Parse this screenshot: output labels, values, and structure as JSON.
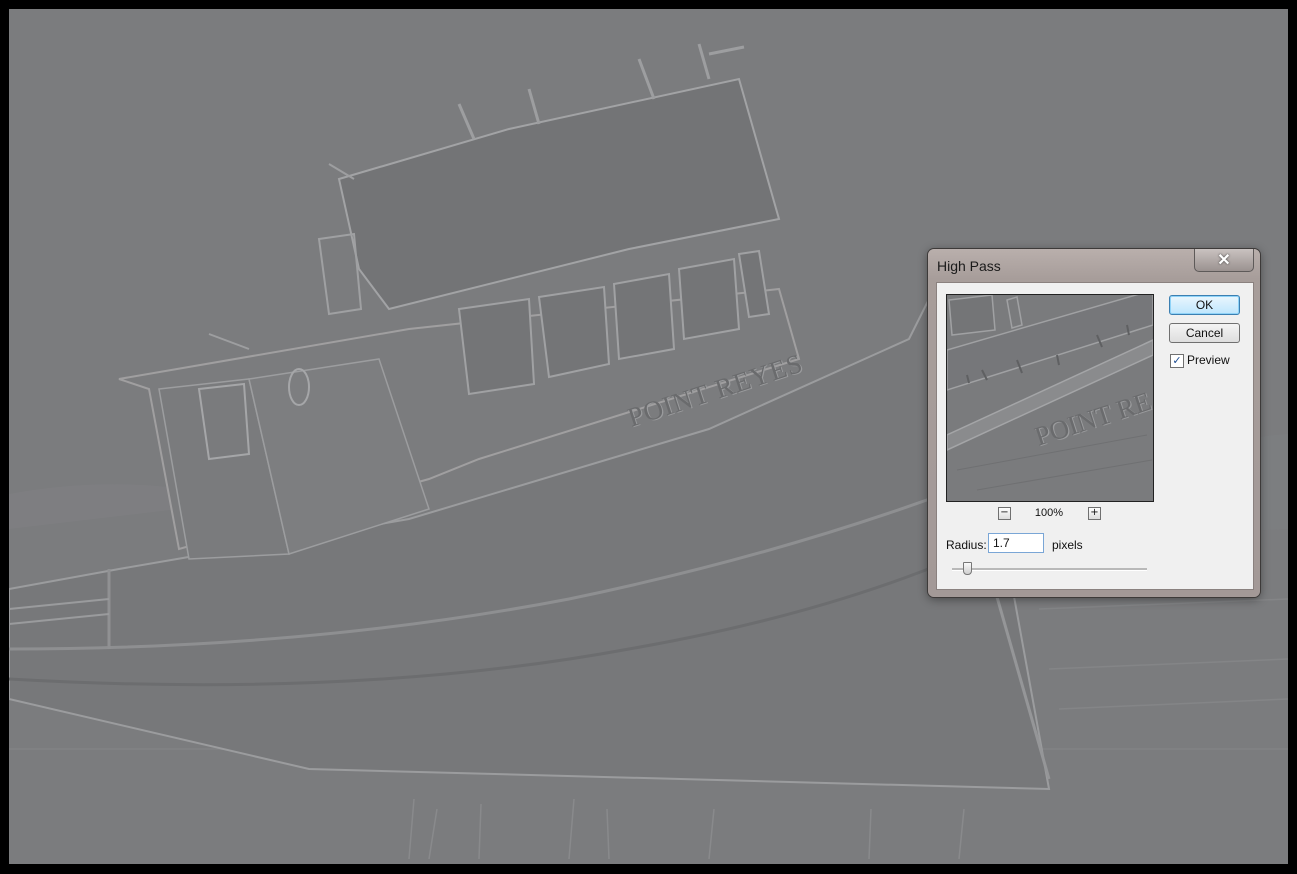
{
  "dialog": {
    "title": "High Pass",
    "close_label": "✕",
    "ok_label": "OK",
    "cancel_label": "Cancel",
    "preview_label": "Preview",
    "preview_checked": true,
    "zoom_out_label": "−",
    "zoom_in_label": "+",
    "zoom_value": "100%",
    "radius_label": "Radius:",
    "radius_value": "1.7",
    "units_label": "pixels",
    "slider_value": 1.7
  },
  "photo": {
    "boat_name": "POINT REYES",
    "background_color": "#7b7c7e"
  },
  "preview": {
    "boat_name": "POINT RE"
  },
  "icons": {
    "close": "close-icon",
    "check": "checkmark-icon"
  }
}
